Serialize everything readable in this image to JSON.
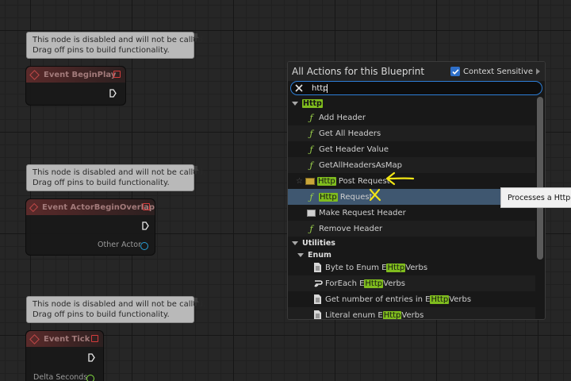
{
  "graph": {
    "disabled_notice": {
      "line1": "This node is disabled and will not be called.",
      "line2": "Drag off pins to build functionality."
    },
    "nodes": [
      {
        "title": "Event BeginPlay"
      },
      {
        "title": "Event ActorBeginOverlap",
        "output_pin": "Other Actor"
      },
      {
        "title": "Event Tick",
        "output_pin": "Delta Seconds"
      }
    ]
  },
  "action_menu": {
    "title": "All Actions for this Blueprint",
    "context_sensitive_label": "Context Sensitive",
    "context_sensitive_checked": true,
    "search_value": "http",
    "category_http": "Http",
    "items": [
      {
        "icon": "function-icon",
        "label": "Add Header"
      },
      {
        "icon": "function-icon",
        "label": "Get All Headers"
      },
      {
        "icon": "function-icon",
        "label": "Get Header Value"
      },
      {
        "icon": "function-icon",
        "label": "GetAllHeadersAsMap"
      },
      {
        "icon": "class-icon",
        "label_match": "Http",
        "label_rest": " Post Request",
        "starred": true
      },
      {
        "icon": "function-icon",
        "label_match": "Http",
        "label_rest": " Request",
        "selected": true
      },
      {
        "icon": "struct-make-icon",
        "label": "Make Request Header"
      },
      {
        "icon": "function-icon",
        "label": "Remove Header"
      }
    ],
    "category_utilities": "Utilities",
    "subcategory_enum": "Enum",
    "enum_items": [
      {
        "icon": "macro-doc-icon",
        "pre": "Byte to Enum E",
        "match": "Http",
        "post": "Verbs"
      },
      {
        "icon": "loop-icon",
        "pre": "ForEach E",
        "match": "Http",
        "post": "Verbs"
      },
      {
        "icon": "macro-doc-icon",
        "pre": "Get number of entries in E",
        "match": "Http",
        "post": "Verbs"
      },
      {
        "icon": "macro-doc-icon",
        "pre": "Literal enum E",
        "match": "Http",
        "post": "Verbs"
      }
    ]
  },
  "tooltip": {
    "text": "Processes a Http request"
  },
  "colors": {
    "highlight": "#7fbc1e",
    "selected_row": "#3f5770",
    "search_border": "#2d7ed6",
    "annotation": "#f2e615",
    "event_pin": "#d43c3c"
  }
}
